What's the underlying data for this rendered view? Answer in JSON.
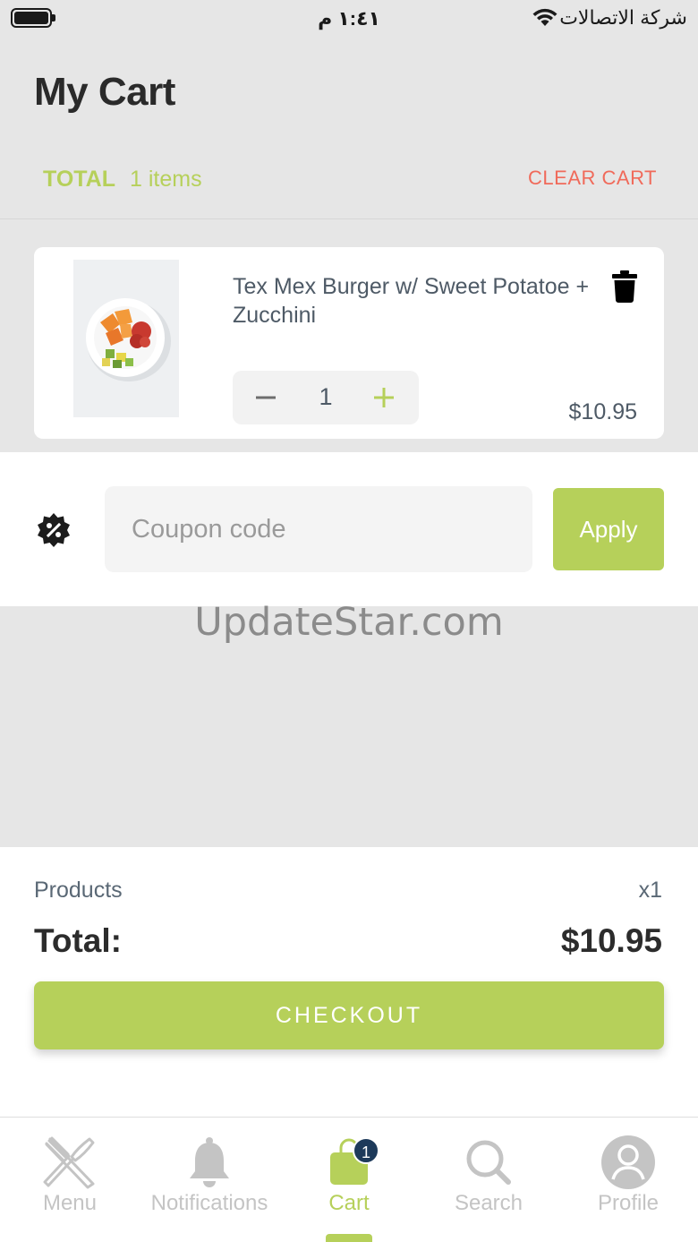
{
  "status_bar": {
    "time": "١:٤١ م",
    "carrier": "شركة الاتصالات"
  },
  "header": {
    "title": "My Cart",
    "total_label": "TOTAL",
    "items_count": "1 items",
    "clear_cart_label": "CLEAR CART"
  },
  "cart": {
    "items": [
      {
        "name": "Tex Mex Burger w/ Sweet Potatoe + Zucchini",
        "quantity": "1",
        "price": "$10.95"
      }
    ]
  },
  "coupon": {
    "placeholder": "Coupon code",
    "apply_label": "Apply"
  },
  "watermark": "UpdateStar.com",
  "summary": {
    "products_label": "Products",
    "products_count": "x1",
    "total_label": "Total:",
    "total_value": "$10.95",
    "checkout_label": "CHECKOUT"
  },
  "tab_bar": {
    "tabs": [
      {
        "label": "Menu",
        "icon": "fork-knife-icon"
      },
      {
        "label": "Notifications",
        "icon": "bell-icon"
      },
      {
        "label": "Cart",
        "icon": "shopping-bag-icon",
        "badge": "1",
        "active": true
      },
      {
        "label": "Search",
        "icon": "search-icon"
      },
      {
        "label": "Profile",
        "icon": "user-icon"
      }
    ]
  },
  "colors": {
    "accent": "#b6d05a",
    "danger": "#f06a5a",
    "badge": "#1d3a5a",
    "background": "#e6e6e6"
  }
}
